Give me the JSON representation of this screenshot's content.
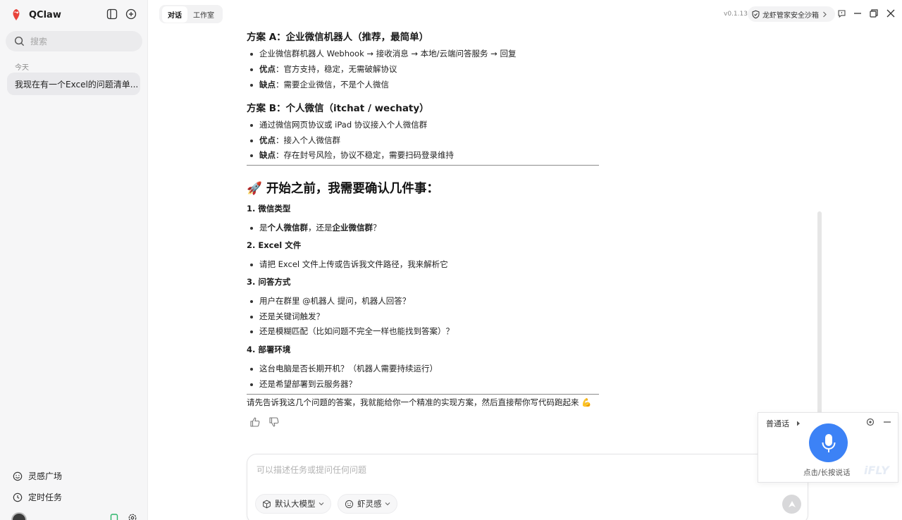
{
  "app": {
    "name": "QClaw",
    "version": "v0.1.13"
  },
  "sidebar": {
    "search_placeholder": "搜索",
    "section_today": "今天",
    "conversations": [
      "我现在有一个Excel的问题清单..."
    ],
    "links": {
      "inspiration": "灵感广场",
      "scheduled": "定时任务"
    }
  },
  "tabs": {
    "chat": "对话",
    "studio": "工作室"
  },
  "topbar": {
    "sandbox": "龙虾管家安全沙箱"
  },
  "message": {
    "plan_a": {
      "title": "方案 A：企业微信机器人（推荐，最简单）",
      "line1": "企业微信群机器人 Webhook → 接收消息 → 本地/云端问答服务 → 回复",
      "pro_label": "优点",
      "pro_text": "：官方支持，稳定，无需破解协议",
      "con_label": "缺点",
      "con_text": "：需要企业微信，不是个人微信"
    },
    "plan_b": {
      "title": "方案 B：个人微信（itchat / wechaty）",
      "line1": "通过微信网页协议或 iPad 协议接入个人微信群",
      "pro_label": "优点",
      "pro_text": "：接入个人微信群",
      "con_label": "缺点",
      "con_text": "：存在封号风险，协议不稳定，需要扫码登录维持"
    },
    "confirm_title": "🚀 开始之前，我需要确认几件事：",
    "q1": {
      "title": "1. 微信类型",
      "pre": "是",
      "b1": "个人微信群",
      "mid": "，还是",
      "b2": "企业微信群",
      "post": "？"
    },
    "q2": {
      "title": "2. Excel 文件",
      "line1": "请把 Excel 文件上传或告诉我文件路径，我来解析它"
    },
    "q3": {
      "title": "3. 问答方式",
      "line1": "用户在群里 @机器人 提问，机器人回答？",
      "line2": "还是关键词触发？",
      "line3": "还是模糊匹配（比如问题不完全一样也能找到答案）？"
    },
    "q4": {
      "title": "4. 部署环境",
      "line1": "这台电脑是否长期开机？（机器人需要持续运行）",
      "line2": "还是希望部署到云服务器？"
    },
    "final": "请先告诉我这几个问题的答案，我就能给你一个精准的实现方案，然后直接帮你写代码跑起来 💪"
  },
  "composer": {
    "placeholder": "可以描述任务或提问任何问题",
    "model_chip": "默认大模型",
    "skill_chip": "虾灵感"
  },
  "voice": {
    "lang": "普通话",
    "hint": "点击/长按说话",
    "brand": "iFLY"
  },
  "colors": {
    "accent": "#3c82f6",
    "logo": "#e8423a"
  }
}
